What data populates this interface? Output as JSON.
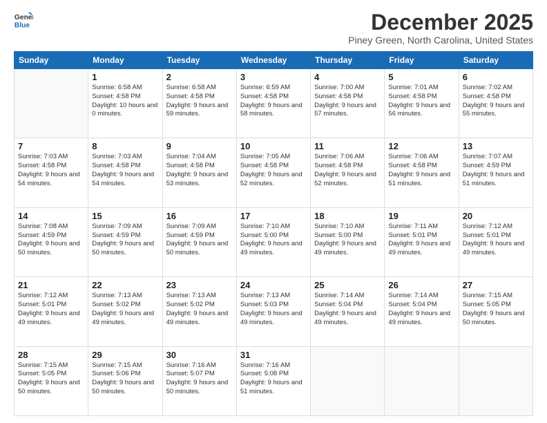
{
  "logo": {
    "line1": "General",
    "line2": "Blue"
  },
  "title": "December 2025",
  "location": "Piney Green, North Carolina, United States",
  "weekdays": [
    "Sunday",
    "Monday",
    "Tuesday",
    "Wednesday",
    "Thursday",
    "Friday",
    "Saturday"
  ],
  "weeks": [
    [
      {
        "day": "",
        "content": ""
      },
      {
        "day": "1",
        "content": "Sunrise: 6:58 AM\nSunset: 4:58 PM\nDaylight: 10 hours\nand 0 minutes."
      },
      {
        "day": "2",
        "content": "Sunrise: 6:58 AM\nSunset: 4:58 PM\nDaylight: 9 hours\nand 59 minutes."
      },
      {
        "day": "3",
        "content": "Sunrise: 6:59 AM\nSunset: 4:58 PM\nDaylight: 9 hours\nand 58 minutes."
      },
      {
        "day": "4",
        "content": "Sunrise: 7:00 AM\nSunset: 4:58 PM\nDaylight: 9 hours\nand 57 minutes."
      },
      {
        "day": "5",
        "content": "Sunrise: 7:01 AM\nSunset: 4:58 PM\nDaylight: 9 hours\nand 56 minutes."
      },
      {
        "day": "6",
        "content": "Sunrise: 7:02 AM\nSunset: 4:58 PM\nDaylight: 9 hours\nand 55 minutes."
      }
    ],
    [
      {
        "day": "7",
        "content": "Sunrise: 7:03 AM\nSunset: 4:58 PM\nDaylight: 9 hours\nand 54 minutes."
      },
      {
        "day": "8",
        "content": "Sunrise: 7:03 AM\nSunset: 4:58 PM\nDaylight: 9 hours\nand 54 minutes."
      },
      {
        "day": "9",
        "content": "Sunrise: 7:04 AM\nSunset: 4:58 PM\nDaylight: 9 hours\nand 53 minutes."
      },
      {
        "day": "10",
        "content": "Sunrise: 7:05 AM\nSunset: 4:58 PM\nDaylight: 9 hours\nand 52 minutes."
      },
      {
        "day": "11",
        "content": "Sunrise: 7:06 AM\nSunset: 4:58 PM\nDaylight: 9 hours\nand 52 minutes."
      },
      {
        "day": "12",
        "content": "Sunrise: 7:06 AM\nSunset: 4:58 PM\nDaylight: 9 hours\nand 51 minutes."
      },
      {
        "day": "13",
        "content": "Sunrise: 7:07 AM\nSunset: 4:59 PM\nDaylight: 9 hours\nand 51 minutes."
      }
    ],
    [
      {
        "day": "14",
        "content": "Sunrise: 7:08 AM\nSunset: 4:59 PM\nDaylight: 9 hours\nand 50 minutes."
      },
      {
        "day": "15",
        "content": "Sunrise: 7:09 AM\nSunset: 4:59 PM\nDaylight: 9 hours\nand 50 minutes."
      },
      {
        "day": "16",
        "content": "Sunrise: 7:09 AM\nSunset: 4:59 PM\nDaylight: 9 hours\nand 50 minutes."
      },
      {
        "day": "17",
        "content": "Sunrise: 7:10 AM\nSunset: 5:00 PM\nDaylight: 9 hours\nand 49 minutes."
      },
      {
        "day": "18",
        "content": "Sunrise: 7:10 AM\nSunset: 5:00 PM\nDaylight: 9 hours\nand 49 minutes."
      },
      {
        "day": "19",
        "content": "Sunrise: 7:11 AM\nSunset: 5:01 PM\nDaylight: 9 hours\nand 49 minutes."
      },
      {
        "day": "20",
        "content": "Sunrise: 7:12 AM\nSunset: 5:01 PM\nDaylight: 9 hours\nand 49 minutes."
      }
    ],
    [
      {
        "day": "21",
        "content": "Sunrise: 7:12 AM\nSunset: 5:01 PM\nDaylight: 9 hours\nand 49 minutes."
      },
      {
        "day": "22",
        "content": "Sunrise: 7:13 AM\nSunset: 5:02 PM\nDaylight: 9 hours\nand 49 minutes."
      },
      {
        "day": "23",
        "content": "Sunrise: 7:13 AM\nSunset: 5:02 PM\nDaylight: 9 hours\nand 49 minutes."
      },
      {
        "day": "24",
        "content": "Sunrise: 7:13 AM\nSunset: 5:03 PM\nDaylight: 9 hours\nand 49 minutes."
      },
      {
        "day": "25",
        "content": "Sunrise: 7:14 AM\nSunset: 5:04 PM\nDaylight: 9 hours\nand 49 minutes."
      },
      {
        "day": "26",
        "content": "Sunrise: 7:14 AM\nSunset: 5:04 PM\nDaylight: 9 hours\nand 49 minutes."
      },
      {
        "day": "27",
        "content": "Sunrise: 7:15 AM\nSunset: 5:05 PM\nDaylight: 9 hours\nand 50 minutes."
      }
    ],
    [
      {
        "day": "28",
        "content": "Sunrise: 7:15 AM\nSunset: 5:05 PM\nDaylight: 9 hours\nand 50 minutes."
      },
      {
        "day": "29",
        "content": "Sunrise: 7:15 AM\nSunset: 5:06 PM\nDaylight: 9 hours\nand 50 minutes."
      },
      {
        "day": "30",
        "content": "Sunrise: 7:16 AM\nSunset: 5:07 PM\nDaylight: 9 hours\nand 50 minutes."
      },
      {
        "day": "31",
        "content": "Sunrise: 7:16 AM\nSunset: 5:08 PM\nDaylight: 9 hours\nand 51 minutes."
      },
      {
        "day": "",
        "content": ""
      },
      {
        "day": "",
        "content": ""
      },
      {
        "day": "",
        "content": ""
      }
    ]
  ]
}
